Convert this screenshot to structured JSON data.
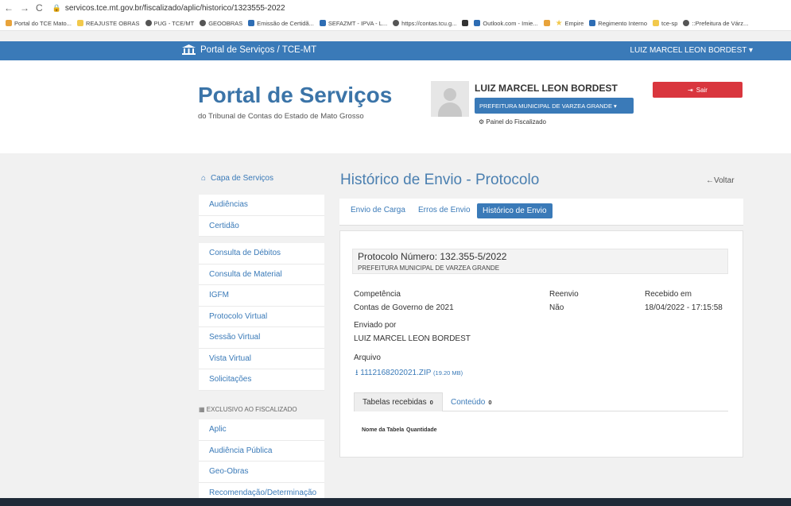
{
  "browser": {
    "back": "←",
    "forward": "→",
    "reload": "C",
    "url": "servicos.tce.mt.gov.br/fiscalizado/aplic/historico/1323555-2022"
  },
  "bookmarks": [
    {
      "label": "Portal do TCE Mato...",
      "color": "#e8a33b"
    },
    {
      "label": "REAJUSTE OBRAS",
      "color": "#f2c94c"
    },
    {
      "label": "PUG - TCE/MT",
      "color": "#555555"
    },
    {
      "label": "GEOOBRAS",
      "color": "#555555"
    },
    {
      "label": "Emissão de Certidã...",
      "color": "#2e6db4"
    },
    {
      "label": "SEFAZMT - IPVA - L...",
      "color": "#2e6db4"
    },
    {
      "label": "https://contas.tcu.g...",
      "color": "#555555"
    },
    {
      "label": "",
      "color": "#333333"
    },
    {
      "label": "Outlook.com - Imie...",
      "color": "#2e6db4"
    },
    {
      "label": "",
      "color": "#e8a33b"
    },
    {
      "label": "Empire",
      "color": "#f2c94c"
    },
    {
      "label": "Regimento Interno",
      "color": "#2e6db4"
    },
    {
      "label": "tce-sp",
      "color": "#f2c94c"
    },
    {
      "label": "::Prefeitura de Várz...",
      "color": "#555555"
    }
  ],
  "topnav": {
    "brand": "Portal de Serviços / TCE-MT",
    "user_menu": "LUIZ MARCEL LEON BORDEST ▾"
  },
  "header": {
    "title": "Portal de Serviços",
    "subtitle": "do Tribunal de Contas do Estado de Mato Grosso",
    "user_name": "LUIZ MARCEL LEON BORDEST",
    "org_select": "PREFEITURA MUNICIPAL DE VARZEA GRANDE ▾",
    "painel": "Painel do Fiscalizado",
    "sair": "Sair"
  },
  "sidebar": {
    "head": "Capa de Serviços",
    "group1": [
      "Audiências",
      "Certidão"
    ],
    "group2": [
      "Consulta de Débitos",
      "Consulta de Material",
      "IGFM",
      "Protocolo Virtual",
      "Sessão Virtual",
      "Vista Virtual",
      "Solicitações"
    ],
    "section": "EXCLUSIVO AO FISCALIZADO",
    "group3": [
      "Aplic",
      "Audiência Pública",
      "Geo-Obras",
      "Recomendação/Determinação"
    ]
  },
  "main": {
    "title": "Histórico de Envio - Protocolo",
    "voltar": "Voltar",
    "tabs": [
      "Envio de Carga",
      "Erros de Envio",
      "Histórico de Envio"
    ],
    "protocolo": "Protocolo Número: 132.355-5/2022",
    "orgao": "PREFEITURA MUNICIPAL DE VARZEA GRANDE",
    "competencia_label": "Competência",
    "competencia_value": "Contas de Governo de 2021",
    "reenvio_label": "Reenvio",
    "reenvio_value": "Não",
    "recebido_label": "Recebido em",
    "recebido_value": "18/04/2022 - 17:15:58",
    "enviado_label": "Enviado por",
    "enviado_value": "LUIZ MARCEL LEON BORDEST",
    "arquivo_label": "Arquivo",
    "arquivo_name": "1112168202021.ZIP",
    "arquivo_size": "(19.20 MB)",
    "subtabs": [
      {
        "label": "Tabelas recebidas",
        "count": "0"
      },
      {
        "label": "Conteúdo",
        "count": "0"
      }
    ],
    "table_headers": [
      "Nome da Tabela",
      "Quantidade"
    ]
  }
}
